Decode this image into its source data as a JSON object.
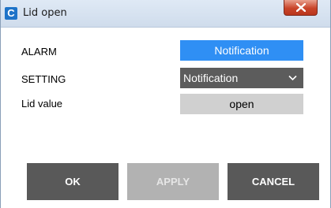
{
  "window": {
    "title": "Lid open",
    "app_icon_letter": "C"
  },
  "rows": {
    "alarm": {
      "label": "ALARM",
      "value": "Notification"
    },
    "setting": {
      "label": "SETTING",
      "value": "Notification"
    },
    "lid": {
      "label": "Lid value",
      "value": "open"
    }
  },
  "buttons": {
    "ok": "OK",
    "apply": "APPLY",
    "cancel": "CANCEL"
  },
  "colors": {
    "alarm_bg": "#2f8ff4",
    "setting_bg": "#5c5c5c",
    "lid_bg": "#d0d0d0",
    "button_bg": "#595959",
    "button_disabled_bg": "#b2b2b2",
    "close_button": "#c9452a"
  }
}
